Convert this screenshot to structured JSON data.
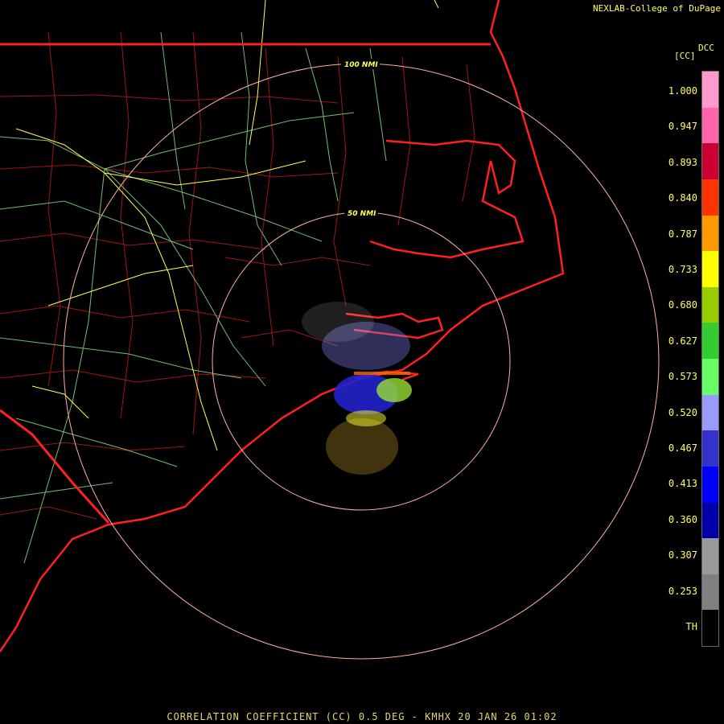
{
  "credit": "NEXLAB-College of DuPage",
  "footer": "CORRELATION COEFFICIENT (CC) 0.5 DEG - KMHX 20 JAN 26 01:02",
  "legend": {
    "title": "DCC",
    "unit": "[CC]",
    "ticks": [
      "1.000",
      "0.947",
      "0.893",
      "0.840",
      "0.787",
      "0.733",
      "0.680",
      "0.627",
      "0.573",
      "0.520",
      "0.467",
      "0.413",
      "0.360",
      "0.307",
      "0.253",
      "TH"
    ],
    "colors": [
      "#ff99cc",
      "#ff66aa",
      "#cc0033",
      "#ff3300",
      "#ff9900",
      "#ffff00",
      "#99cc00",
      "#33cc33",
      "#66ff66",
      "#9999ff",
      "#3333cc",
      "#0000ff",
      "#0000aa",
      "#999999",
      "#808080",
      "#000000"
    ]
  },
  "rings": [
    {
      "label": "50 NMI"
    },
    {
      "label": "100 NMI"
    }
  ],
  "colors": {
    "state": "#ff2020",
    "county": "#b01818",
    "highway": "#ffff55",
    "road": "#88dd88",
    "ring": "#ffb0a0"
  }
}
